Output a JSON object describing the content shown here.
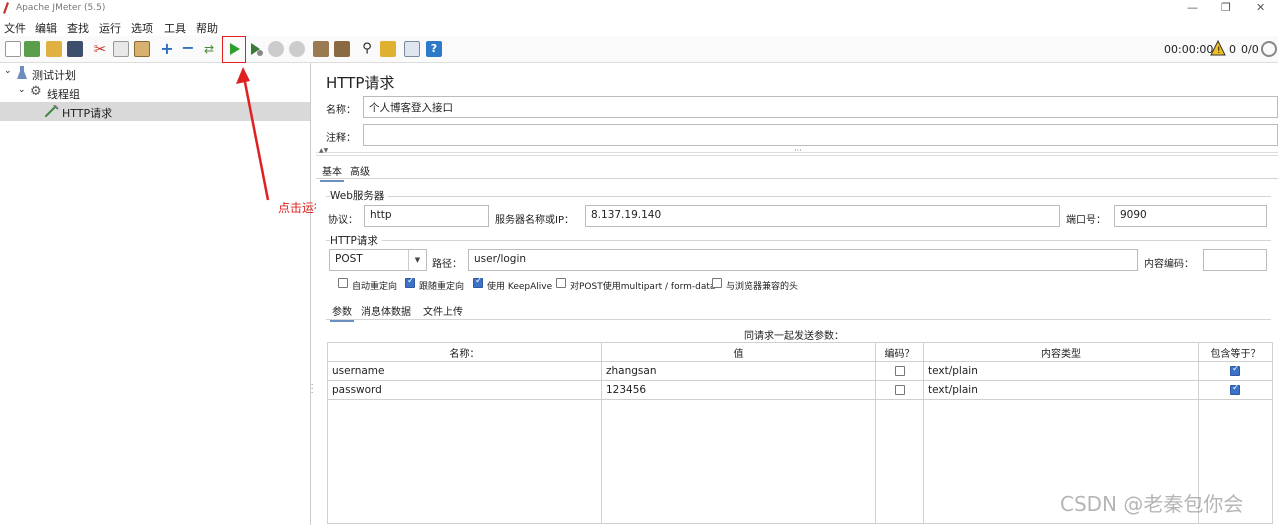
{
  "window": {
    "title": "Apache JMeter (5.5)"
  },
  "menu": [
    "文件",
    "编辑",
    "查找",
    "运行",
    "选项",
    "工具",
    "帮助"
  ],
  "toolbar": {
    "timer": "00:00:00",
    "warnings": "0",
    "threads": "0/0"
  },
  "tree": {
    "items": [
      {
        "label": "测试计划"
      },
      {
        "label": "线程组"
      },
      {
        "label": "HTTP请求"
      }
    ]
  },
  "annotation": {
    "text": "点击运行"
  },
  "sampler": {
    "title": "HTTP请求",
    "name_label": "名称：",
    "name_value": "个人博客登入接口",
    "comment_label": "注释：",
    "comment_value": "",
    "tabs": [
      "基本",
      "高级"
    ],
    "web_server": {
      "title": "Web服务器",
      "protocol_label": "协议：",
      "protocol": "http",
      "server_label": "服务器名称或IP：",
      "server": "8.137.19.140",
      "port_label": "端口号：",
      "port": "9090"
    },
    "http_request": {
      "title": "HTTP请求",
      "method": "POST",
      "path_label": "路径：",
      "path": "user/login",
      "encoding_label": "内容编码：",
      "encoding": "",
      "options": [
        {
          "label": "自动重定向",
          "checked": false
        },
        {
          "label": "跟随重定向",
          "checked": true
        },
        {
          "label": "使用 KeepAlive",
          "checked": true
        },
        {
          "label": "对POST使用multipart / form-data",
          "checked": false
        },
        {
          "label": "与浏览器兼容的头",
          "checked": false
        }
      ]
    },
    "param_tabs": [
      "参数",
      "消息体数据",
      "文件上传"
    ],
    "params_caption": "同请求一起发送参数：",
    "columns": [
      "名称：",
      "值",
      "编码？",
      "内容类型",
      "包含等于？"
    ],
    "rows": [
      {
        "name": "username",
        "value": "zhangsan",
        "encode": false,
        "content_type": "text/plain",
        "include_equals": true
      },
      {
        "name": "password",
        "value": "123456",
        "encode": false,
        "content_type": "text/plain",
        "include_equals": true
      }
    ]
  },
  "watermark": "CSDN @老秦包你会"
}
